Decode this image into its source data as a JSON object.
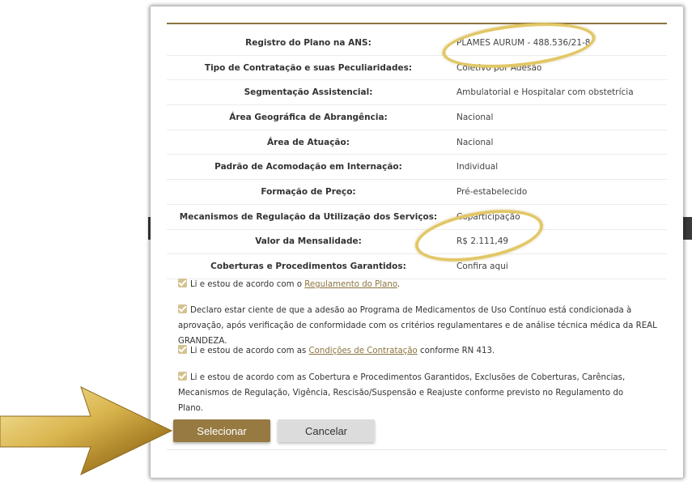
{
  "plan_details": [
    {
      "label": "Registro do Plano na ANS:",
      "value": "PLAMES AURUM - 488.536/21-8"
    },
    {
      "label": "Tipo de Contratação e suas Peculiaridades:",
      "value": "Coletivo por Adesão"
    },
    {
      "label": "Segmentação Assistencial:",
      "value": "Ambulatorial e Hospitalar com obstetrícia"
    },
    {
      "label": "Área Geográfica de Abrangência:",
      "value": "Nacional"
    },
    {
      "label": "Área de Atuação:",
      "value": "Nacional"
    },
    {
      "label": "Padrão de Acomodação em Internação:",
      "value": "Individual"
    },
    {
      "label": "Formação de Preço:",
      "value": "Pré-estabelecido"
    },
    {
      "label": "Mecanismos de Regulação da Utilização dos Serviços:",
      "value": "Coparticipação"
    },
    {
      "label": "Valor da Mensalidade:",
      "value": "R$ 2.111,49"
    },
    {
      "label": "Coberturas e Procedimentos Garantidos:",
      "value": "Confira aqui"
    }
  ],
  "agreements": {
    "regulamento": {
      "prefix": "Li e estou de acordo com o ",
      "link": "Regulamento do Plano",
      "suffix": "."
    },
    "medicamentos": {
      "text": "Declaro estar ciente de que a adesão ao Programa de Medicamentos de Uso Contínuo está condicionada à aprovação, após verificação de conformidade com os critérios regulamentares e de análise técnica médica da REAL GRANDEZA."
    },
    "condicoes": {
      "prefix": "Li e estou de acordo com as ",
      "link": "Condições de Contratação",
      "suffix": " conforme RN 413."
    },
    "coberturas": {
      "text": "Li e estou de acordo com as Cobertura e Procedimentos Garantidos, Exclusões de Coberturas, Carências, Mecanismos de Regulação, Vigência, Rescisão/Suspensão e Reajuste conforme previsto no Regulamento do Plano."
    }
  },
  "buttons": {
    "select": "Selecionar",
    "cancel": "Cancelar"
  },
  "colors": {
    "accent": "#977a42",
    "checkbox": "#d4c291",
    "highlight": "#e2c766"
  }
}
